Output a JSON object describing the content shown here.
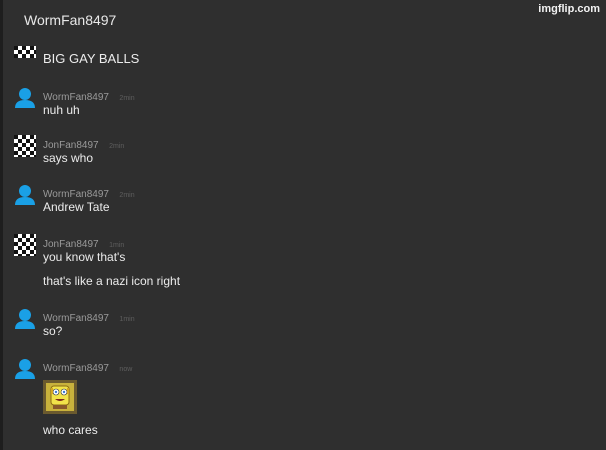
{
  "header": {
    "title": "WormFan8497"
  },
  "watermark": {
    "text": "imgflip.com"
  },
  "colors": {
    "background": "#2f2f2f",
    "user_icon": "#1aa0e6",
    "checker_dark": "#111111",
    "checker_light": "#ffffff"
  },
  "first_message": {
    "avatar_icon": "checkerboard-icon",
    "text": "BIG GAY BALLS"
  },
  "messages": [
    {
      "username": "WormFan8497",
      "time": "2min",
      "avatar_icon": "user-icon",
      "lines": [
        "nuh uh"
      ]
    },
    {
      "username": "JonFan8497",
      "time": "2min",
      "avatar_icon": "checkerboard-icon",
      "lines": [
        "says who"
      ]
    },
    {
      "username": "WormFan8497",
      "time": "2min",
      "avatar_icon": "user-icon",
      "lines": [
        "Andrew Tate"
      ]
    },
    {
      "username": "JonFan8497",
      "time": "1min",
      "avatar_icon": "checkerboard-icon",
      "lines": [
        "you know that's",
        "that's like a nazi icon right"
      ]
    },
    {
      "username": "WormFan8497",
      "time": "1min",
      "avatar_icon": "user-icon",
      "lines": [
        "so?"
      ]
    },
    {
      "username": "WormFan8497",
      "time": "now",
      "avatar_icon": "user-icon",
      "sticker_icon": "spongebob-sticker-icon",
      "lines": [
        "who cares"
      ]
    }
  ]
}
